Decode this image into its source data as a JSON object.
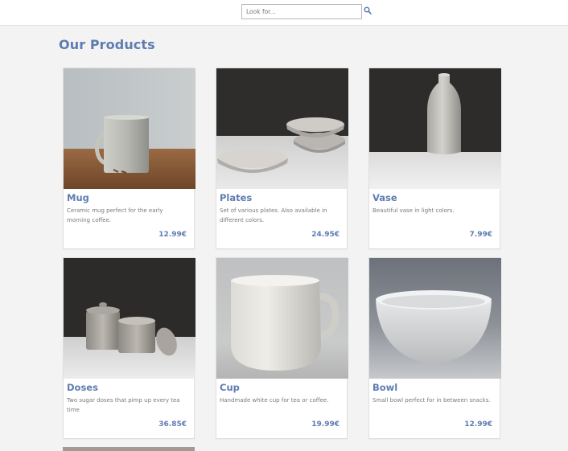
{
  "header": {
    "search_placeholder": "Look for...",
    "search_icon": "search-icon"
  },
  "page": {
    "title": "Our Products"
  },
  "products": [
    {
      "name": "Mug",
      "description": "Ceramic mug perfect for the early morning coffee.",
      "price": "12.99€"
    },
    {
      "name": "Plates",
      "description": "Set of various plates. Also available in different colors.",
      "price": "24.95€"
    },
    {
      "name": "Vase",
      "description": "Beautiful vase in light colors.",
      "price": "7.99€"
    },
    {
      "name": "Doses",
      "description": "Two sugar doses that pimp up every tea time",
      "price": "36.85€"
    },
    {
      "name": "Cup",
      "description": "Handmade white cup for tea or coffee.",
      "price": "19.99€"
    },
    {
      "name": "Bowl",
      "description": "Small bowl perfect for in between snacks.",
      "price": "12.99€"
    }
  ],
  "colors": {
    "accent": "#5f7cb2",
    "background": "#f3f3f3"
  }
}
